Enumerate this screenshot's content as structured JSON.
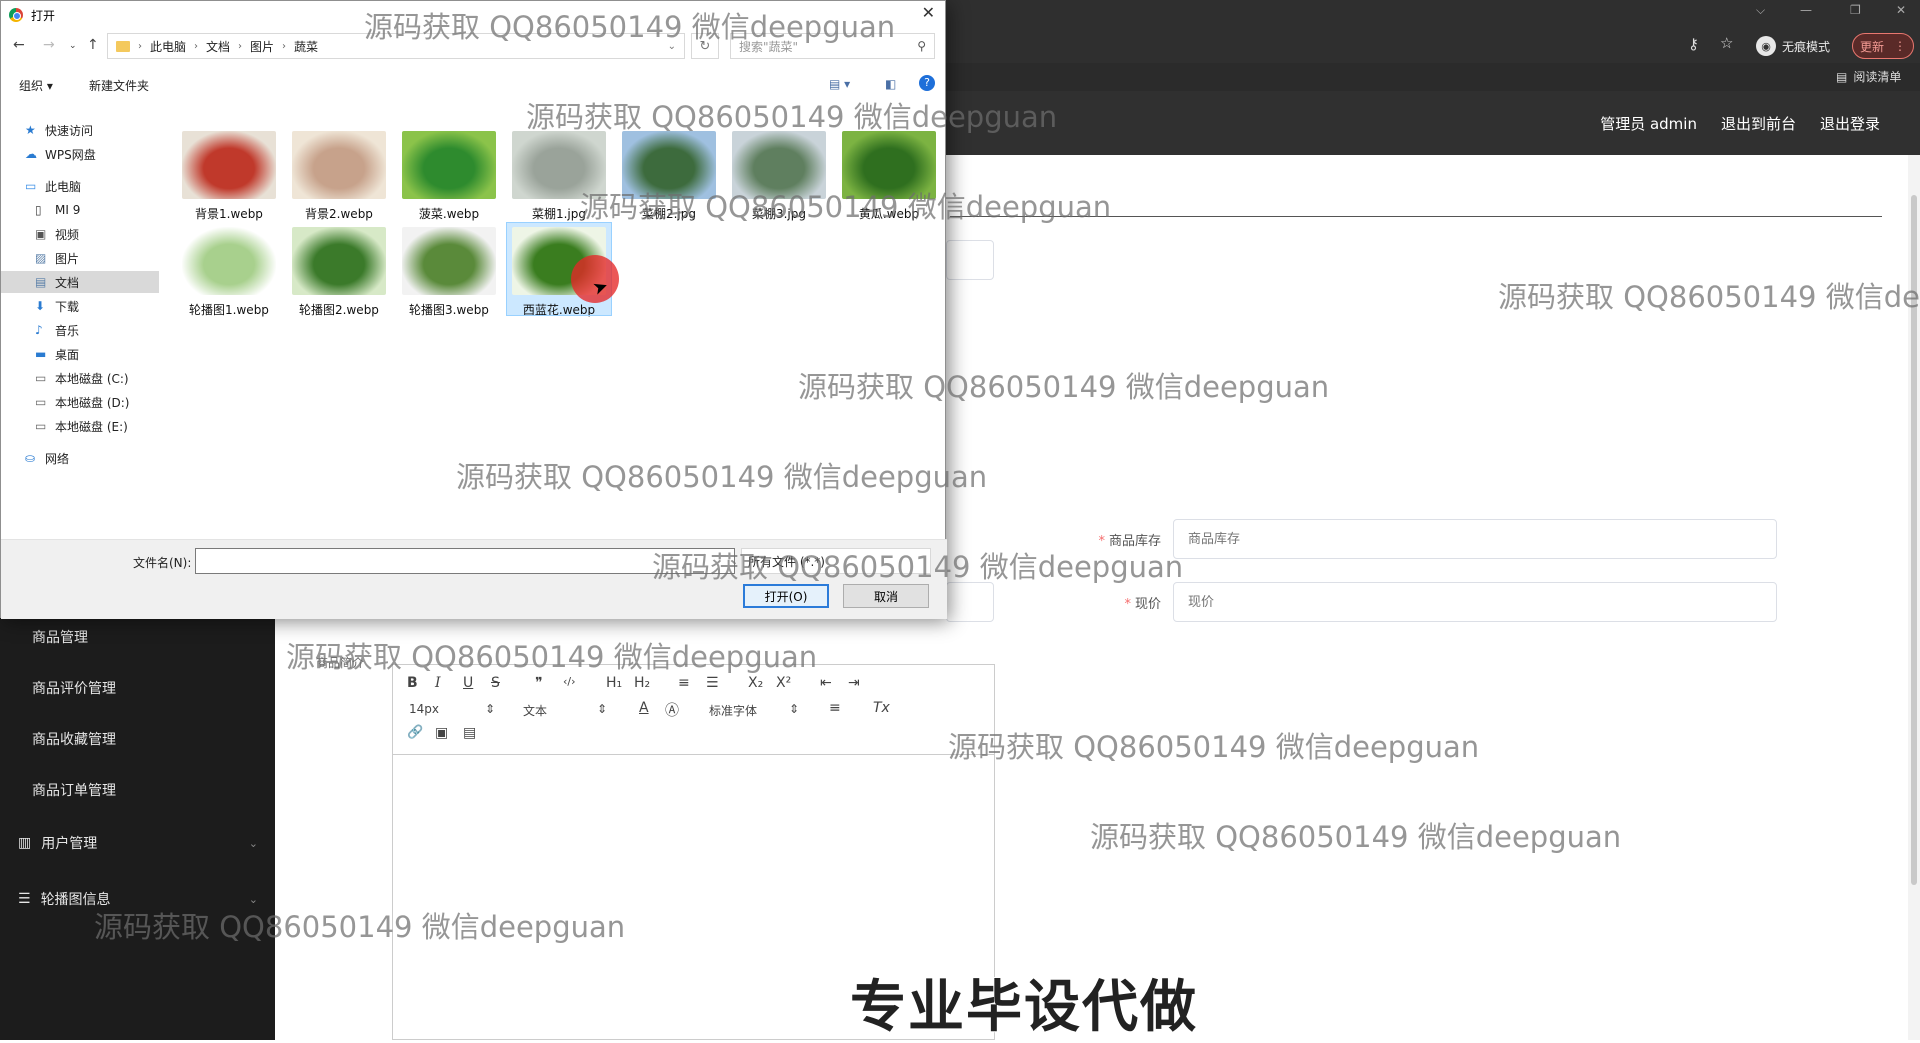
{
  "browser": {
    "incognito_label": "无痕模式",
    "update_label": "更新",
    "reading_list_label": "阅读清单"
  },
  "app_header": {
    "admin_label": "管理员 admin",
    "exit_front_label": "退出到前台",
    "logout_label": "退出登录"
  },
  "sidebar": {
    "items": [
      {
        "label": "商品管理"
      },
      {
        "label": "商品评价管理"
      },
      {
        "label": "商品收藏管理"
      },
      {
        "label": "商品订单管理"
      }
    ],
    "groups": [
      {
        "label": "用户管理",
        "icon": "bar-chart-icon"
      },
      {
        "label": "轮播图信息",
        "icon": "sliders-icon"
      }
    ]
  },
  "form": {
    "stock": {
      "label": "商品库存",
      "placeholder": "商品库存"
    },
    "price": {
      "label": "现价",
      "placeholder": "现价"
    },
    "intro_label": "商品简介"
  },
  "editor": {
    "font_size": "14px",
    "text_type": "文本",
    "font_family": "标准字体",
    "buttons": {
      "bold": "B",
      "italic": "I",
      "underline": "U",
      "strike": "S",
      "quote": "❞",
      "code": "‹/›",
      "h1": "H₁",
      "h2": "H₂",
      "ol": "≡",
      "ul": "☰",
      "sub": "X₂",
      "sup": "X²",
      "outdent": "⇤",
      "indent": "⇥",
      "color": "A",
      "bg": "Ⓐ",
      "align": "≡",
      "clear": "Tx",
      "link": "🔗",
      "image": "▣",
      "video": "▤"
    }
  },
  "dialog": {
    "title": "打开",
    "path": [
      "此电脑",
      "文档",
      "图片",
      "蔬菜"
    ],
    "search_placeholder": "搜索\"蔬菜\"",
    "organize_label": "组织 ▾",
    "new_folder_label": "新建文件夹",
    "tree": [
      {
        "label": "快速访问",
        "icon": "star-icon",
        "indent": 0
      },
      {
        "label": "WPS网盘",
        "icon": "cloud-icon",
        "indent": 0
      },
      {
        "label": "此电脑",
        "icon": "computer-icon",
        "indent": 0
      },
      {
        "label": "MI 9",
        "icon": "phone-icon",
        "indent": 1
      },
      {
        "label": "视频",
        "icon": "video-icon",
        "indent": 1
      },
      {
        "label": "图片",
        "icon": "picture-icon",
        "indent": 1
      },
      {
        "label": "文档",
        "icon": "document-icon",
        "indent": 1
      },
      {
        "label": "下载",
        "icon": "download-icon",
        "indent": 1
      },
      {
        "label": "音乐",
        "icon": "music-icon",
        "indent": 1
      },
      {
        "label": "桌面",
        "icon": "desktop-icon",
        "indent": 1
      },
      {
        "label": "本地磁盘 (C:)",
        "icon": "drive-icon",
        "indent": 1
      },
      {
        "label": "本地磁盘 (D:)",
        "icon": "drive-icon",
        "indent": 1
      },
      {
        "label": "本地磁盘 (E:)",
        "icon": "drive-icon",
        "indent": 1
      },
      {
        "label": "网络",
        "icon": "network-icon",
        "indent": 0
      }
    ],
    "selected_tree_item": "文档",
    "files": [
      {
        "name": "背景1.webp",
        "colors": [
          "#c0392b",
          "#e8e1d6"
        ]
      },
      {
        "name": "背景2.webp",
        "colors": [
          "#c7a28b",
          "#efe5d6"
        ]
      },
      {
        "name": "菠菜.webp",
        "colors": [
          "#2e8b2e",
          "#8bc34a"
        ]
      },
      {
        "name": "菜棚1.jpg",
        "colors": [
          "#9aa39a",
          "#cfd6cf"
        ]
      },
      {
        "name": "菜棚2.jpg",
        "colors": [
          "#3d6b3d",
          "#9fc0e0"
        ]
      },
      {
        "name": "菜棚3.jpg",
        "colors": [
          "#5f7f5f",
          "#c9d3d9"
        ]
      },
      {
        "name": "黄瓜.webp",
        "colors": [
          "#2f6f1f",
          "#7cb342"
        ]
      },
      {
        "name": "轮播图1.webp",
        "colors": [
          "#a8d08d",
          "#ffffff"
        ]
      },
      {
        "name": "轮播图2.webp",
        "colors": [
          "#3b7a2a",
          "#d7e9c7"
        ]
      },
      {
        "name": "轮播图3.webp",
        "colors": [
          "#5a8a3a",
          "#f2f2f2"
        ]
      },
      {
        "name": "西蓝花.webp",
        "colors": [
          "#3a7d1f",
          "#eef5e6"
        ]
      }
    ],
    "selected_file": "西蓝花.webp",
    "filename_label": "文件名(N):",
    "filename_value": "",
    "filter_label": "所有文件 (*.*)",
    "open_label": "打开(O)",
    "cancel_label": "取消"
  },
  "watermark_text": "源码获取 QQ86050149 微信deepguan",
  "caption": "专业毕设代做"
}
